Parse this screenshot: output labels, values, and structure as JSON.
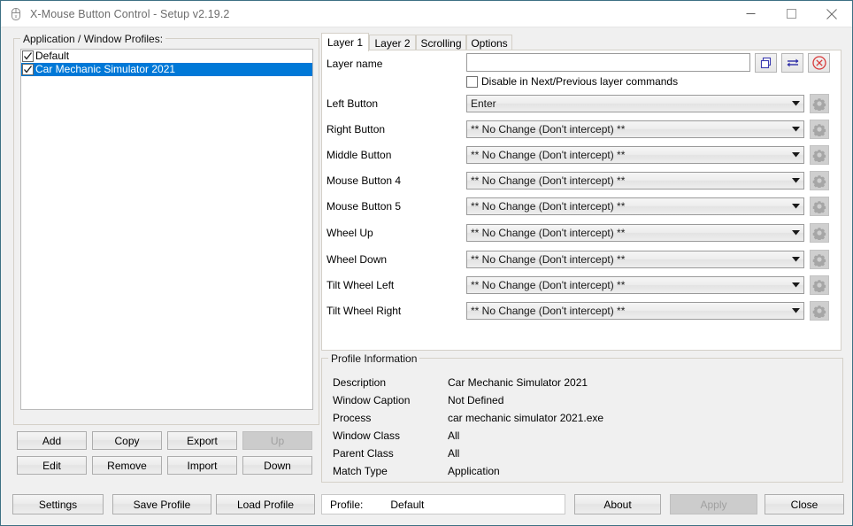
{
  "window": {
    "title": "X-Mouse Button Control - Setup v2.19.2",
    "app_icon": "mouse-icon",
    "minimize_icon": "minimize-icon",
    "maximize_icon": "maximize-icon",
    "close_icon": "close-icon",
    "border_color": "#3d7083"
  },
  "profiles_panel": {
    "group_title": "Application / Window Profiles:",
    "items": [
      {
        "label": "Default",
        "checked": true,
        "selected": false
      },
      {
        "label": "Car Mechanic Simulator 2021",
        "checked": true,
        "selected": true
      }
    ],
    "selection_color": "#0078d7",
    "buttons": [
      {
        "label": "Add",
        "enabled": true
      },
      {
        "label": "Copy",
        "enabled": true
      },
      {
        "label": "Export",
        "enabled": true
      },
      {
        "label": "Up",
        "enabled": false
      },
      {
        "label": "Edit",
        "enabled": true
      },
      {
        "label": "Remove",
        "enabled": true
      },
      {
        "label": "Import",
        "enabled": true
      },
      {
        "label": "Down",
        "enabled": true
      }
    ]
  },
  "tabs": [
    {
      "label": "Layer 1",
      "active": true
    },
    {
      "label": "Layer 2",
      "active": false
    },
    {
      "label": "Scrolling",
      "active": false
    },
    {
      "label": "Options",
      "active": false
    }
  ],
  "layer": {
    "name_label": "Layer name",
    "name_value": "",
    "name_placeholder": "",
    "copy_layer_icon": "copy-layer-icon",
    "swap_layer_icon": "swap-arrows-icon",
    "clear_layer_icon": "clear-circle-icon",
    "disable_checkbox_label": "Disable in Next/Previous layer commands",
    "disable_checkbox_checked": false
  },
  "button_rows": [
    {
      "label": "Left Button",
      "value": "Enter",
      "gear_icon": "gear-icon",
      "gear_enabled": false
    },
    {
      "label": "Right Button",
      "value": "** No Change (Don't intercept) **",
      "gear_icon": "gear-icon",
      "gear_enabled": false
    },
    {
      "label": "Middle Button",
      "value": "** No Change (Don't intercept) **",
      "gear_icon": "gear-icon",
      "gear_enabled": false
    },
    {
      "label": "Mouse Button 4",
      "value": "** No Change (Don't intercept) **",
      "gear_icon": "gear-icon",
      "gear_enabled": false
    },
    {
      "label": "Mouse Button 5",
      "value": "** No Change (Don't intercept) **",
      "gear_icon": "gear-icon",
      "gear_enabled": false
    },
    {
      "label": "Wheel Up",
      "value": "** No Change (Don't intercept) **",
      "gear_icon": "gear-icon",
      "gear_enabled": false
    },
    {
      "label": "Wheel Down",
      "value": "** No Change (Don't intercept) **",
      "gear_icon": "gear-icon",
      "gear_enabled": false
    },
    {
      "label": "Tilt Wheel Left",
      "value": "** No Change (Don't intercept) **",
      "gear_icon": "gear-icon",
      "gear_enabled": false
    },
    {
      "label": "Tilt Wheel Right",
      "value": "** No Change (Don't intercept) **",
      "gear_icon": "gear-icon",
      "gear_enabled": false
    }
  ],
  "profile_information": {
    "group_title": "Profile Information",
    "fields": [
      {
        "label": "Description",
        "value": "Car Mechanic Simulator 2021"
      },
      {
        "label": "Window Caption",
        "value": "Not Defined"
      },
      {
        "label": "Process",
        "value": "car mechanic simulator 2021.exe"
      },
      {
        "label": "Window Class",
        "value": "All"
      },
      {
        "label": "Parent Class",
        "value": "All"
      },
      {
        "label": "Match Type",
        "value": "Application"
      }
    ]
  },
  "bottom_bar": {
    "settings_label": "Settings",
    "save_profile_label": "Save Profile",
    "load_profile_label": "Load Profile",
    "profile_status_label": "Profile:",
    "profile_status_value": "Default",
    "about_label": "About",
    "apply_label": "Apply",
    "apply_enabled": false,
    "close_label": "Close"
  }
}
